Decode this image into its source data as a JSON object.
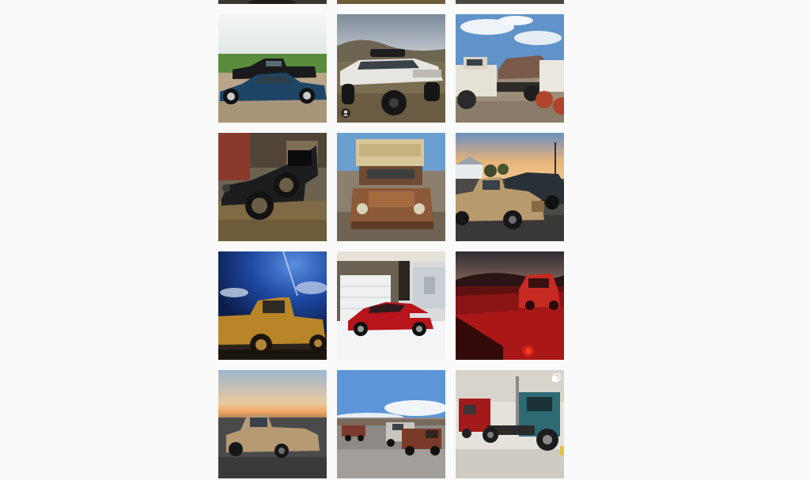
{
  "feed": {
    "posts": [
      {
        "subject": "hidden-post-1",
        "badge": ""
      },
      {
        "subject": "hidden-post-2",
        "badge": ""
      },
      {
        "subject": "hidden-post-3",
        "badge": ""
      },
      {
        "subject": "blue-muscle-car-and-pickup",
        "badge": ""
      },
      {
        "subject": "lifted-white-classic-car",
        "badge": "user-tag-icon"
      },
      {
        "subject": "white-tow-truck-with-wrecks",
        "badge": ""
      },
      {
        "subject": "black-vintage-model-a",
        "badge": ""
      },
      {
        "subject": "rusty-box-truck-laundry",
        "badge": ""
      },
      {
        "subject": "tan-1930s-pickup-at-sunset",
        "badge": ""
      },
      {
        "subject": "gold-pickup-under-night-sky",
        "badge": ""
      },
      {
        "subject": "red-mustang-in-snow",
        "badge": ""
      },
      {
        "subject": "red-lit-truck-in-field",
        "badge": ""
      },
      {
        "subject": "tan-pickup-at-dusk",
        "badge": ""
      },
      {
        "subject": "trucks-in-parking-lot",
        "badge": ""
      },
      {
        "subject": "teal-cabover-semi-in-shop",
        "badge": "carousel-icon"
      }
    ],
    "colors": {
      "background": "#fafafa"
    }
  }
}
